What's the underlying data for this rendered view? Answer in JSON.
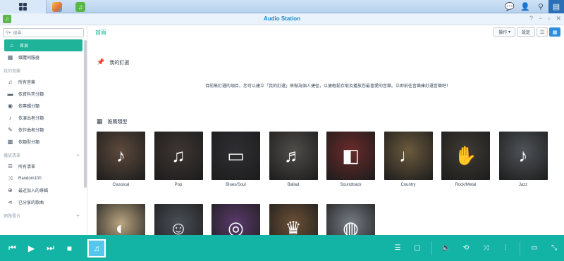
{
  "taskbar": {
    "main_menu_icon": "grid-icon",
    "apps": [
      {
        "name": "photo-station-icon",
        "color": "#e9a23b"
      },
      {
        "name": "audio-station-icon",
        "color": "#57b847"
      }
    ],
    "right_icons": [
      "chat-icon",
      "user-icon",
      "search-icon",
      "widgets-icon"
    ]
  },
  "window": {
    "title": "Audio Station",
    "controls": [
      "?",
      "−",
      "▫",
      "✕"
    ]
  },
  "sidebar": {
    "search_placeholder": "搜尋",
    "items_top": [
      {
        "label": "首頁",
        "icon": "home-icon",
        "active": true
      },
      {
        "label": "媒體伺服器",
        "icon": "server-icon",
        "active": false
      }
    ],
    "library_header": "我的音樂",
    "library_items": [
      {
        "label": "所有音樂",
        "icon": "music-note-icon"
      },
      {
        "label": "依資料夾分類",
        "icon": "folder-icon"
      },
      {
        "label": "依專輯分類",
        "icon": "disc-icon"
      },
      {
        "label": "依演出者分類",
        "icon": "microphone-icon"
      },
      {
        "label": "依作曲者分類",
        "icon": "pen-icon"
      },
      {
        "label": "依類型分類",
        "icon": "tiles-icon"
      }
    ],
    "playlist_header": "播放清單",
    "playlist_items": [
      {
        "label": "所有清單",
        "icon": "list-icon"
      },
      {
        "label": "Random100",
        "icon": "shuffle-icon"
      },
      {
        "label": "最近加入的專輯",
        "icon": "plus-circle-icon"
      },
      {
        "label": "已分享的歌曲",
        "icon": "share-icon"
      }
    ],
    "radio_header": "網路電台"
  },
  "main": {
    "breadcrumb": "首頁",
    "tools": {
      "action_label": "操作",
      "settings_label": "設定"
    },
    "pin_title": "我的釘選",
    "pin_text": "目前無釘選的項目。您可以建立「我的釘選」來做為個人捷徑，以便輕鬆存取及播放您最喜愛的音樂。立即前往音樂庫釘選音樂吧！",
    "genre_title": "推薦類型",
    "genres": [
      {
        "label": "Classical",
        "icon": "piano-icon",
        "color": "#5d4a3c"
      },
      {
        "label": "Pop",
        "icon": "microphone-icon",
        "color": "#3d3532"
      },
      {
        "label": "Blues/Soul",
        "icon": "radio-icon",
        "color": "#2f2f33"
      },
      {
        "label": "Ballad",
        "icon": "music-notes-icon",
        "color": "#4f4d4a"
      },
      {
        "label": "Soundtrack",
        "icon": "speakers-icon",
        "color": "#6b2a2a"
      },
      {
        "label": "Country",
        "icon": "guitar-icon",
        "color": "#6b5a3d"
      },
      {
        "label": "Rock/Metal",
        "icon": "rock-hand-icon",
        "color": "#3f3a33"
      },
      {
        "label": "Jazz",
        "icon": "saxophone-icon",
        "color": "#4f5358"
      },
      {
        "label": "",
        "icon": "sunglasses-icon",
        "color": "#b9a580"
      },
      {
        "label": "",
        "icon": "afro-icon",
        "color": "#4a4f57"
      },
      {
        "label": "",
        "icon": "boombox-icon",
        "color": "#5a3a6b"
      },
      {
        "label": "",
        "icon": "lion-icon",
        "color": "#6b4f36"
      },
      {
        "label": "",
        "icon": "globe-icon",
        "color": "#777d86"
      }
    ]
  },
  "player": {
    "controls": [
      "previous-icon",
      "play-icon",
      "next-icon",
      "stop-icon"
    ],
    "right_icons": [
      "queue-icon",
      "lyrics-icon",
      "volume-icon",
      "repeat-icon",
      "shuffle-icon",
      "equalizer-icon",
      "screen-icon",
      "expand-icon"
    ]
  }
}
